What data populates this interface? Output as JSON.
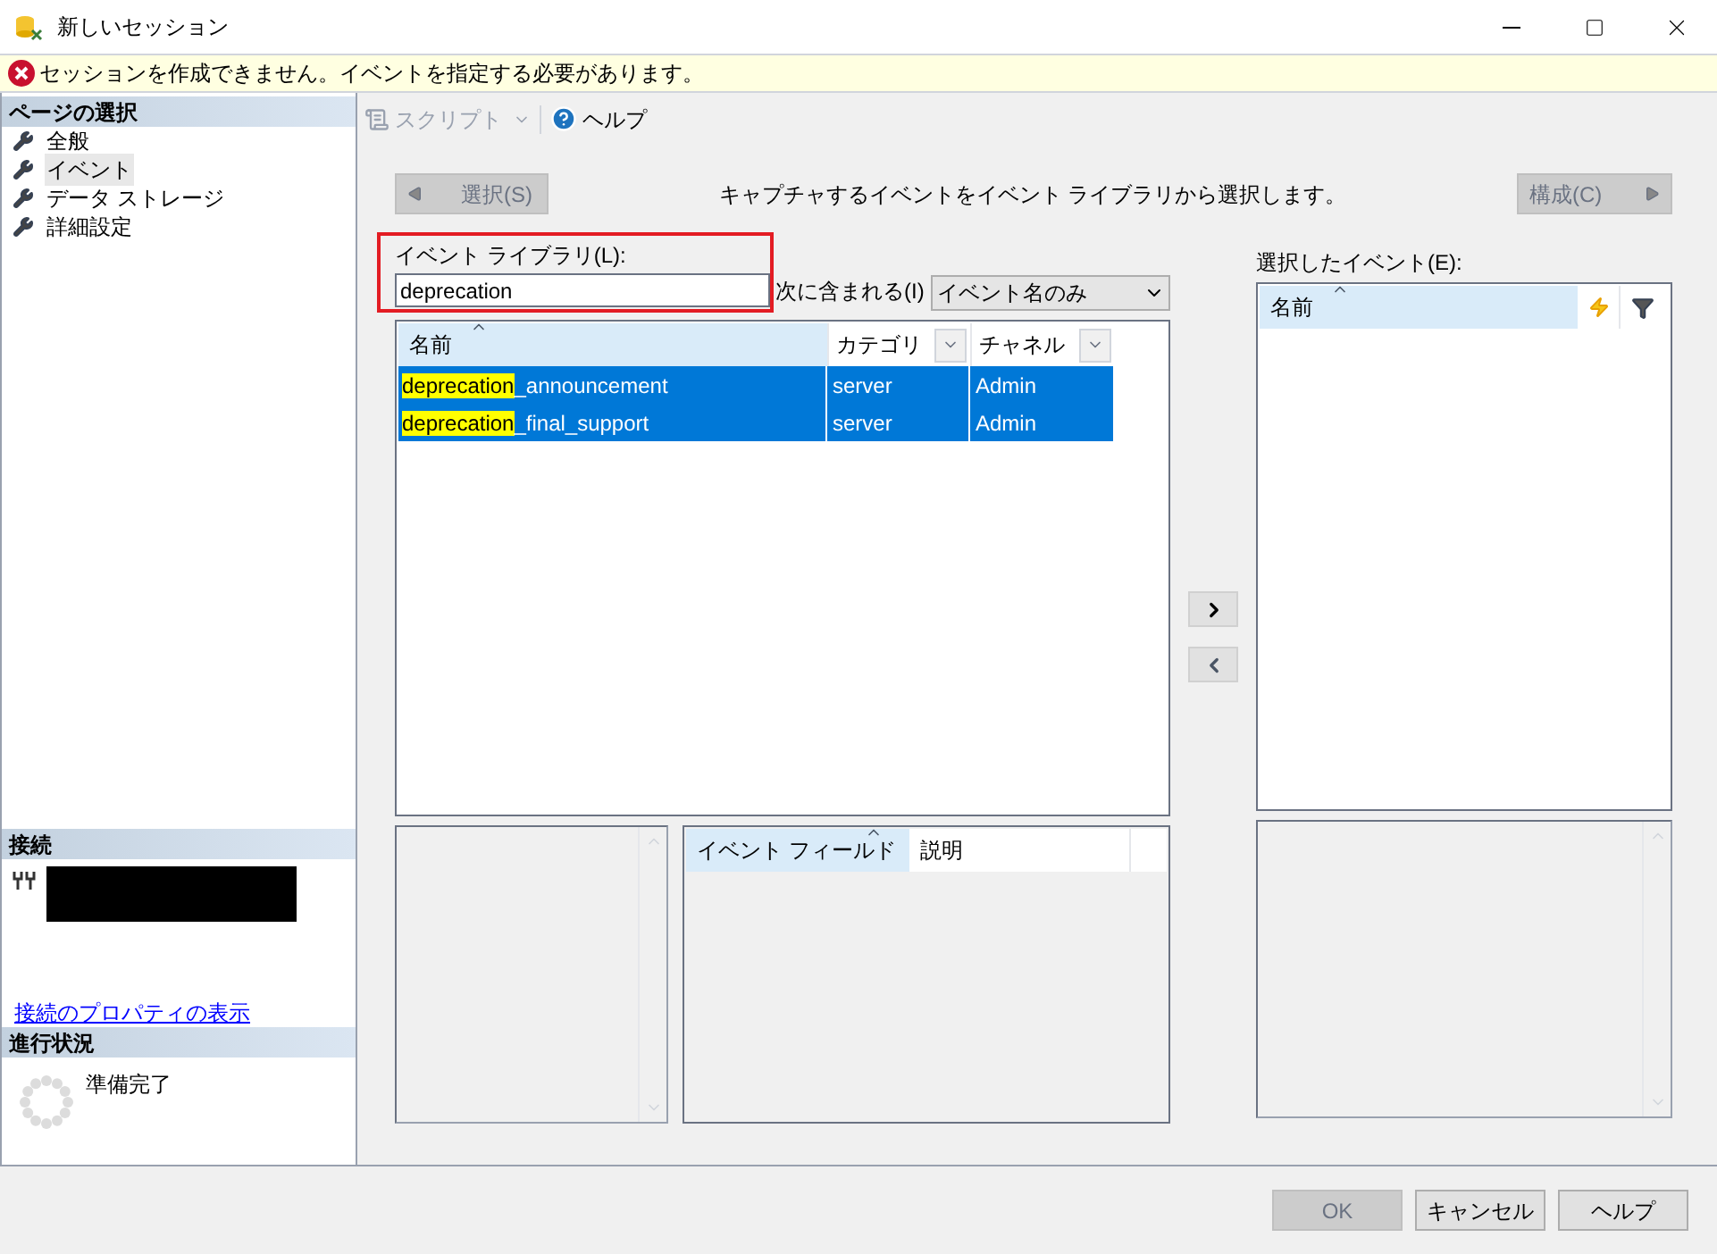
{
  "window": {
    "title": "新しいセッション"
  },
  "error_bar": {
    "message": "セッションを作成できません。イベントを指定する必要があります。"
  },
  "sidebar": {
    "header": "ページの選択",
    "items": [
      {
        "label": "全般",
        "selected": false
      },
      {
        "label": "イベント",
        "selected": true
      },
      {
        "label": "データ ストレージ",
        "selected": false
      },
      {
        "label": "詳細設定",
        "selected": false
      }
    ],
    "connection": {
      "header": "接続",
      "link": "接続のプロパティの表示"
    },
    "progress": {
      "header": "進行状況",
      "status": "準備完了"
    }
  },
  "toolbar": {
    "script": "スクリプト",
    "help": "ヘルプ"
  },
  "events_page": {
    "select_button": {
      "label": "選択(S)",
      "disabled": true
    },
    "instruction": "キャプチャするイベントをイベント ライブラリから選択します。",
    "configure_button": {
      "label": "構成(C)",
      "disabled": true
    },
    "library_label": "イベント ライブラリ(L):",
    "search": {
      "value": "deprecation"
    },
    "filter_label": "次に含まれる(I)",
    "filter_dropdown": "イベント名のみ",
    "library_table": {
      "columns": [
        "名前",
        "カテゴリ",
        "チャネル"
      ],
      "rows": [
        {
          "name_match": "deprecation",
          "name_rest": "_announcement",
          "category": "server",
          "channel": "Admin",
          "selected": true
        },
        {
          "name_match": "deprecation",
          "name_rest": "_final_support",
          "category": "server",
          "channel": "Admin",
          "selected": true
        }
      ]
    },
    "selected_label": "選択したイベント(E):",
    "selected_table": {
      "columns": [
        "名前"
      ]
    },
    "fields_table": {
      "columns": [
        "イベント フィールド",
        "説明"
      ]
    }
  },
  "buttons": [
    {
      "label": "OK",
      "disabled": true
    },
    {
      "label": "キャンセル",
      "disabled": false
    },
    {
      "label": "ヘルプ",
      "disabled": false
    }
  ]
}
